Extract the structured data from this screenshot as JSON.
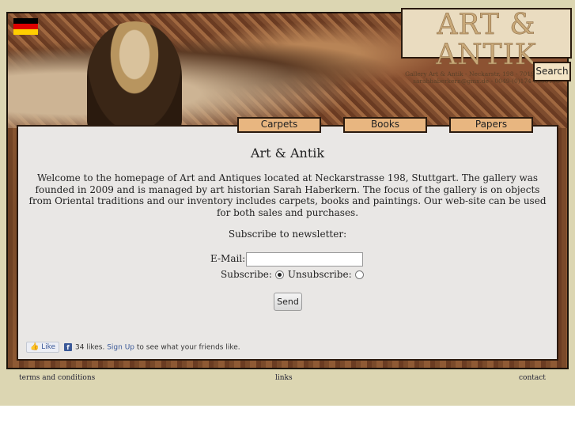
{
  "language_flag": {
    "icon": "germany-flag-icon",
    "colors": [
      "#000000",
      "#dd0000",
      "#ffce00"
    ]
  },
  "logo": {
    "title": "ART & ANTIK",
    "line1": "Gallery Art & Antik  -  Neckarstr. 198  -  70190 Stuttgart",
    "line2": "sarahhaberkern@gmx.de  -  0049-(0)174-8206118"
  },
  "search": {
    "label": "Search"
  },
  "nav": {
    "tabs": [
      {
        "label": "Carpets"
      },
      {
        "label": "Books"
      },
      {
        "label": "Papers"
      }
    ]
  },
  "main": {
    "heading": "Art & Antik",
    "welcome": "Welcome to the homepage of Art and Antiques located at Neckarstrasse 198, Stuttgart. The gallery was founded in 2009 and is managed by art historian Sarah Haberkern. The focus of the gallery is on objects from Oriental traditions and our inventory includes carpets, books and paintings. Our web-site can be used for both sales and purchases."
  },
  "newsletter": {
    "title": "Subscribe to newsletter:",
    "email_label": "E-Mail:",
    "email_value": "",
    "subscribe_label": "Subscribe:",
    "unsubscribe_label": "Unsubscribe:",
    "selected": "subscribe",
    "send_label": "Send"
  },
  "facebook": {
    "like_label": "Like",
    "count_text": "34 likes.",
    "signup_label": "Sign Up",
    "suffix": "to see what your friends like."
  },
  "footer": {
    "terms": "terms and conditions",
    "links": "links",
    "contact": "contact"
  }
}
